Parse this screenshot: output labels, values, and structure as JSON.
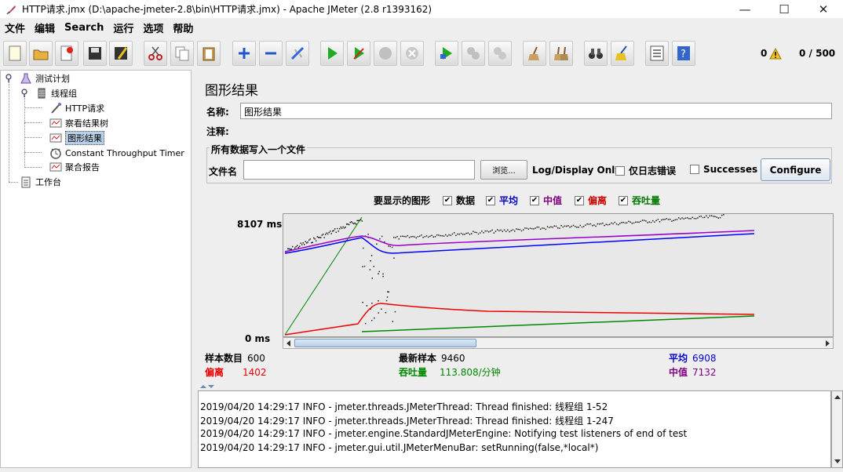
{
  "window": {
    "title": "HTTP请求.jmx (D:\\apache-jmeter-2.8\\bin\\HTTP请求.jmx) - Apache JMeter (2.8 r1393162)",
    "minimize": "—",
    "maximize": "☐",
    "close": "✕"
  },
  "menu": [
    "文件",
    "编辑",
    "Search",
    "运行",
    "选项",
    "帮助"
  ],
  "toolbar": {
    "warnings": "0",
    "threads": "0 / 500"
  },
  "tree": {
    "nodes": [
      "测试计划",
      "线程组",
      "HTTP请求",
      "察看结果树",
      "图形结果",
      "Constant Throughput Timer",
      "聚合报告",
      "工作台"
    ]
  },
  "panel": {
    "title": "图形结果",
    "name_label": "名称:",
    "name_value": "图形结果",
    "comment_label": "注释:",
    "comment_value": "",
    "fileset_legend": "所有数据写入一个文件",
    "filename_label": "文件名",
    "filename_value": "",
    "browse_label": "浏览...",
    "log_display_label": "Log/Display Only:",
    "errors_label": "仅日志错误",
    "successes_label": "Successes",
    "configure_label": "Configure"
  },
  "graph_options": {
    "label": "要显示的图形",
    "items": [
      {
        "label": "数据",
        "checked": true,
        "color": "#000000"
      },
      {
        "label": "平均",
        "checked": true,
        "color": "#0000cc"
      },
      {
        "label": "中值",
        "checked": true,
        "color": "#800080"
      },
      {
        "label": "偏离",
        "checked": true,
        "color": "#cc0000"
      },
      {
        "label": "吞吐量",
        "checked": true,
        "color": "#007700"
      }
    ]
  },
  "axis": {
    "max_label": "8107 ms",
    "min_label": "0 ms"
  },
  "stats": {
    "samples_label": "样本数目",
    "samples_value": "600",
    "latest_label": "最新样本",
    "latest_value": "9460",
    "average_label": "平均",
    "average_value": "6908",
    "deviation_label": "偏离",
    "deviation_value": "1402",
    "throughput_label": "吞吐量",
    "throughput_value": "113.808/分钟",
    "median_label": "中值",
    "median_value": "7132"
  },
  "log": [
    "2019/04/20 14:29:17 INFO  - jmeter.threads.JMeterThread: Thread finished: 线程组 1-52",
    "2019/04/20 14:29:17 INFO  - jmeter.threads.JMeterThread: Thread finished: 线程组 1-247",
    "2019/04/20 14:29:17 INFO  - jmeter.engine.StandardJMeterEngine: Notifying test listeners of end of test",
    "2019/04/20 14:29:17 INFO  - jmeter.gui.util.JMeterMenuBar: setRunning(false,*local*)"
  ],
  "colors": {
    "data": "#000000",
    "average": "#0000ff",
    "median": "#9900cc",
    "deviation": "#ee0000",
    "throughput": "#008800"
  }
}
